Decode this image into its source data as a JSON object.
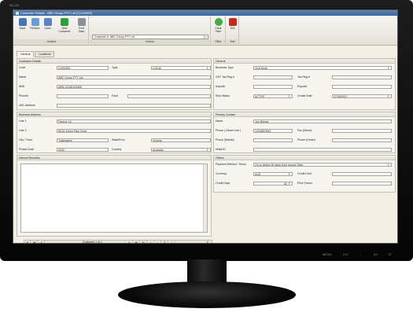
{
  "window": {
    "title": "Customer Details - ABC Group PTY Ltd (CUS0005)",
    "model_label": "ML249"
  },
  "toolbar": {
    "save": "Save",
    "refresh": "Refresh",
    "undo": "Undo",
    "new_customer": "New Customer",
    "print_data": "Print Data",
    "actions_label": "Actions",
    "customer_field": "Customer #: ABC Group PTY Ltd",
    "criteria_label": "Criteria",
    "clear_filter": "Clear Filter",
    "filter_label": "Filter",
    "exit": "Exit",
    "exit_group_label": "Exit"
  },
  "tabs": [
    "General",
    "Locations"
  ],
  "contractor": {
    "title": "Contractor Details",
    "code_label": "Code",
    "code": "CUS0005",
    "type_label": "Type",
    "type": "LOCAL",
    "name_label": "Name",
    "name": "ABC Group PTY Ltd",
    "abn_label": "ABN",
    "abn": "ABN-12345123456",
    "phone_label": "Phone#",
    "fax_label": "Fax#",
    "url_label": "URL Address"
  },
  "general": {
    "title": "General",
    "business_type_label": "Business Type",
    "business_type": "Civil Work",
    "gst_tax_label": "GST Tax Reg #",
    "tax_reg_label": "Tax Reg #",
    "import_label": "Import#",
    "export_label": "Export#",
    "row_status_label": "Row Status",
    "row_status": "ACTIVE",
    "create_date_label": "Create Date",
    "create_date": "07/08/2012"
  },
  "address": {
    "title": "Business Address",
    "line1_label": "Line 1",
    "line1": "Factory 1#",
    "line2_label": "Line 2",
    "line2": "85-81 Keilor Park Drive",
    "city_label": "City / Town",
    "city": "Tullamarine",
    "state_label": "State/Prov.",
    "state": "Victoria",
    "postal_label": "Postal Code",
    "postal": "3043",
    "country_label": "Country",
    "country": "Australia"
  },
  "contact": {
    "title": "Primary Contact",
    "name_label": "Name",
    "name": "Joe Bloggs",
    "phone_direct_label": "Phone ( Direct Line )",
    "phone_direct": "123456789/1",
    "fax_direct_label": "Fax (Direct)",
    "phone_mobile_label": "Phone (Mobile)",
    "phone_home_label": "Phone (Home)",
    "email_label": "eMail ID"
  },
  "remarks": {
    "title": "Internal Remarks"
  },
  "others": {
    "title": "Others",
    "payment_label": "Payment Method / Terms",
    "payment": "On or before 60 days from Invoice Date",
    "currency_label": "Currency",
    "currency": "AUD",
    "credit_limit_label": "Credit Limit",
    "credit_days_label": "Credit Days",
    "credit_days": "60",
    "price_factor_label": "Price Factor"
  },
  "navigator": {
    "text": "Customer 1 of 1"
  },
  "monitor_controls": [
    "MENU",
    "∧/∨",
    "←",
    "i/O",
    "⏻"
  ]
}
